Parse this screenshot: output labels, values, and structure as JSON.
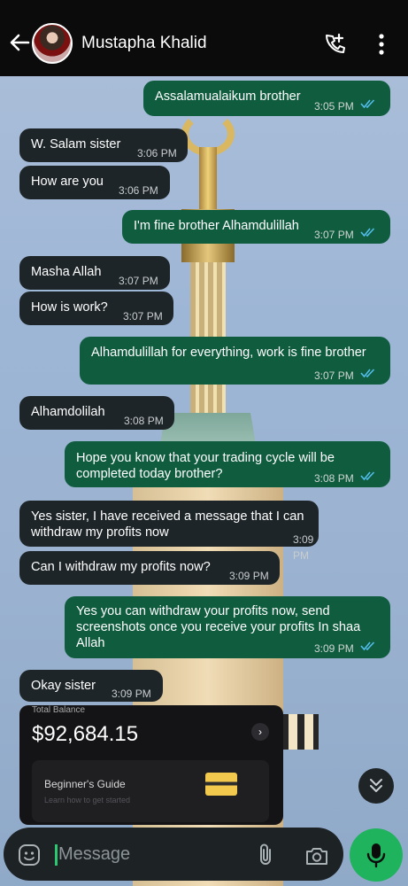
{
  "header": {
    "contact_name": "Mustapha Khalid",
    "icons": [
      "back-arrow-icon",
      "avatar",
      "add-call-icon",
      "more-vert-icon"
    ]
  },
  "messages": [
    {
      "dir": "out",
      "text": "Assalamualaikum brother",
      "time": "3:05 PM",
      "read": true
    },
    {
      "dir": "in",
      "text": "W. Salam sister",
      "time": "3:06 PM"
    },
    {
      "dir": "in",
      "text": "How are you",
      "time": "3:06 PM"
    },
    {
      "dir": "out",
      "text": "I'm fine brother Alhamdulillah",
      "time": "3:07 PM",
      "read": true
    },
    {
      "dir": "in",
      "text": "Masha Allah",
      "time": "3:07 PM"
    },
    {
      "dir": "in",
      "text": "How is work?",
      "time": "3:07 PM"
    },
    {
      "dir": "out",
      "text": "Alhamdulillah for everything, work is fine brother",
      "time": "3:07 PM",
      "read": true
    },
    {
      "dir": "in",
      "text": "Alhamdolilah",
      "time": "3:08 PM"
    },
    {
      "dir": "out",
      "text": "Hope you know that your trading cycle will be completed today brother?",
      "lines": [
        "Hope you know that your trading cycle will be",
        "completed today brother?"
      ],
      "time": "3:08 PM",
      "read": true
    },
    {
      "dir": "in",
      "text": "Yes sister, I have received a message that I can withdraw my profits now",
      "lines": [
        "Yes sister, I have received a message that I can",
        "withdraw my profits now"
      ],
      "time": "3:09 PM"
    },
    {
      "dir": "in",
      "text": "Can I withdraw my profits now?",
      "time": "3:09 PM"
    },
    {
      "dir": "out",
      "text": "Yes you can withdraw your profits now, send screenshots once you receive your profits In shaa Allah",
      "lines": [
        "Yes you can withdraw your profits now, send",
        "screenshots once you receive your profits In shaa",
        "Allah"
      ],
      "time": "3:09 PM",
      "read": true
    },
    {
      "dir": "in",
      "text": "Okay sister",
      "time": "3:09 PM"
    }
  ],
  "image_message": {
    "balance_label": "Total Balance",
    "balance_amount": "$92,684.15",
    "guide_title": "Beginner's Guide",
    "guide_subtitle": "Learn how to get started"
  },
  "composer": {
    "placeholder": "Message",
    "icons": [
      "sticker-icon",
      "attach-icon",
      "camera-icon",
      "mic-icon"
    ]
  },
  "colors": {
    "outgoing_bubble": "#0f5c3f",
    "incoming_bubble": "#1e2528",
    "read_ticks": "#53bdeb",
    "accent": "#1eb35c"
  }
}
